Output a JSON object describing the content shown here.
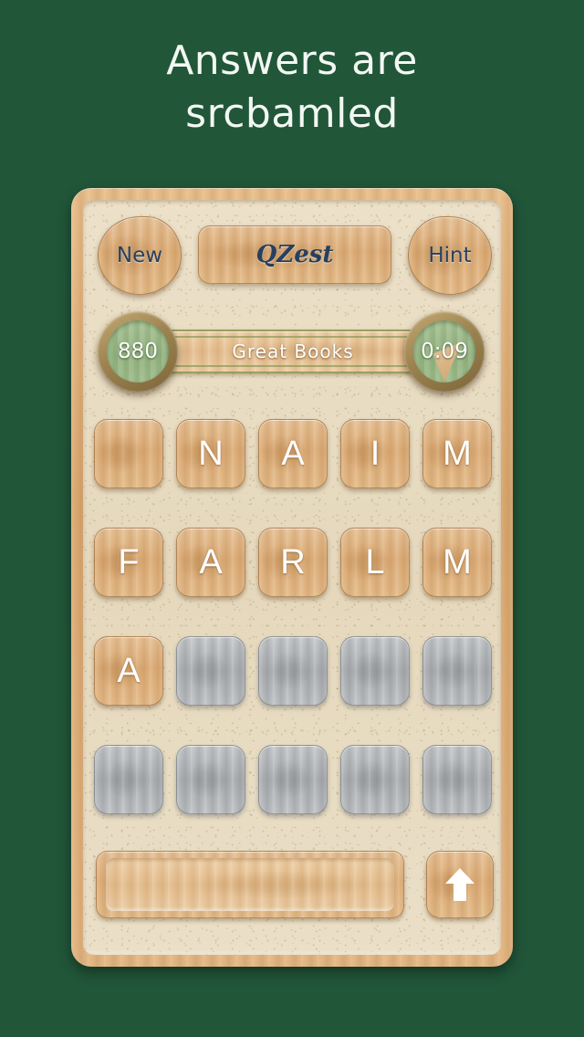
{
  "headline": {
    "line1": "Answers are",
    "line2": "srcbamled"
  },
  "colors": {
    "background": "#215639",
    "headline_text": "#f3f7f2",
    "board_frame": "#dcac77",
    "cork_panel": "#e9ddc3",
    "button_label": "#27405f",
    "tile_letter": "#ffffff",
    "dial_face_green": "#96b583",
    "dial_ring_brass": "#9c8350",
    "locked_tile": "#b0b2b4"
  },
  "toolbar": {
    "new_label": "New",
    "title_label": "QZest",
    "hint_label": "Hint"
  },
  "status": {
    "score": "880",
    "category": "Great Books",
    "timer": "0:09",
    "timer_elapsed_degrees": 22
  },
  "grid": {
    "rows": [
      [
        {
          "letter": "",
          "state": "available"
        },
        {
          "letter": "N",
          "state": "available"
        },
        {
          "letter": "A",
          "state": "available"
        },
        {
          "letter": "I",
          "state": "available"
        },
        {
          "letter": "M",
          "state": "available"
        }
      ],
      [
        {
          "letter": "F",
          "state": "available"
        },
        {
          "letter": "A",
          "state": "available"
        },
        {
          "letter": "R",
          "state": "available"
        },
        {
          "letter": "L",
          "state": "available"
        },
        {
          "letter": "M",
          "state": "available"
        }
      ],
      [
        {
          "letter": "A",
          "state": "available"
        },
        {
          "letter": "",
          "state": "locked"
        },
        {
          "letter": "",
          "state": "locked"
        },
        {
          "letter": "",
          "state": "locked"
        },
        {
          "letter": "",
          "state": "locked"
        }
      ],
      [
        {
          "letter": "",
          "state": "locked"
        },
        {
          "letter": "",
          "state": "locked"
        },
        {
          "letter": "",
          "state": "locked"
        },
        {
          "letter": "",
          "state": "locked"
        },
        {
          "letter": "",
          "state": "locked"
        }
      ]
    ]
  },
  "answer": {
    "value": "",
    "placeholder": "",
    "submit_icon": "arrow-up-icon"
  }
}
